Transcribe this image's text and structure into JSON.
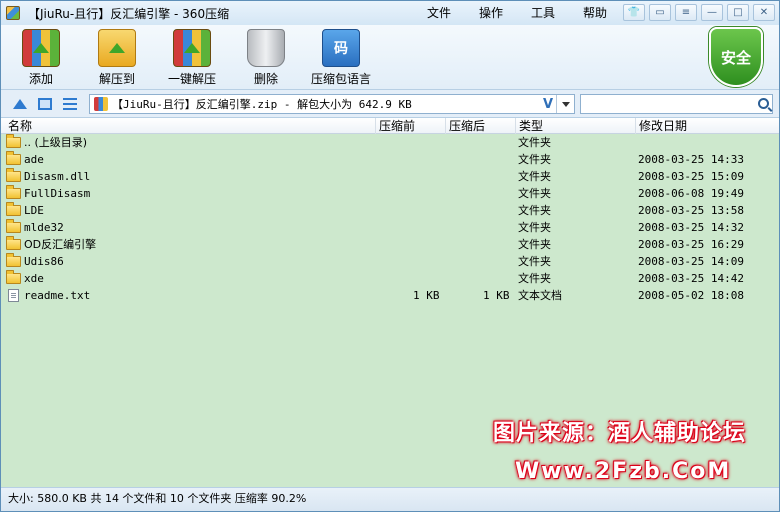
{
  "window": {
    "title": "【JiuRu-且行】反汇编引擎 - 360压缩"
  },
  "menu": [
    "文件",
    "操作",
    "工具",
    "帮助"
  ],
  "window_controls": {
    "skin": "👕",
    "feedback": "▭",
    "menu": "≡",
    "minimize": "—",
    "maximize": "□",
    "close": "✕"
  },
  "toolbar": [
    {
      "label": "添加",
      "icon": "add-archive-icon"
    },
    {
      "label": "解压到",
      "icon": "extract-to-icon"
    },
    {
      "label": "一键解压",
      "icon": "one-click-extract-icon"
    },
    {
      "label": "删除",
      "icon": "trash-icon"
    },
    {
      "label": "压缩包语言",
      "icon": "archive-language-icon",
      "glyph": "码"
    }
  ],
  "security_badge": "安全",
  "address": {
    "path": "【JiuRu-且行】反汇编引擎.zip - 解包大小为 642.9 KB",
    "v_marker": "V",
    "search_placeholder": ""
  },
  "columns": [
    "名称",
    "压缩前",
    "压缩后",
    "类型",
    "修改日期"
  ],
  "files": [
    {
      "name": ".. (上级目录)",
      "size": "",
      "packed": "",
      "type": "文件夹",
      "modified": "",
      "kind": "folder"
    },
    {
      "name": "ade",
      "size": "",
      "packed": "",
      "type": "文件夹",
      "modified": "2008-03-25 14:33",
      "kind": "folder"
    },
    {
      "name": "Disasm.dll",
      "size": "",
      "packed": "",
      "type": "文件夹",
      "modified": "2008-03-25 15:09",
      "kind": "folder"
    },
    {
      "name": "FullDisasm",
      "size": "",
      "packed": "",
      "type": "文件夹",
      "modified": "2008-06-08 19:49",
      "kind": "folder"
    },
    {
      "name": "LDE",
      "size": "",
      "packed": "",
      "type": "文件夹",
      "modified": "2008-03-25 13:58",
      "kind": "folder"
    },
    {
      "name": "mlde32",
      "size": "",
      "packed": "",
      "type": "文件夹",
      "modified": "2008-03-25 14:32",
      "kind": "folder"
    },
    {
      "name": "OD反汇编引擎",
      "size": "",
      "packed": "",
      "type": "文件夹",
      "modified": "2008-03-25 16:29",
      "kind": "folder"
    },
    {
      "name": "Udis86",
      "size": "",
      "packed": "",
      "type": "文件夹",
      "modified": "2008-03-25 14:09",
      "kind": "folder"
    },
    {
      "name": "xde",
      "size": "",
      "packed": "",
      "type": "文件夹",
      "modified": "2008-03-25 14:42",
      "kind": "folder"
    },
    {
      "name": "readme.txt",
      "size": "1 KB",
      "packed": "1 KB",
      "type": "文本文档",
      "modified": "2008-05-02 18:08",
      "kind": "file"
    }
  ],
  "watermark": {
    "line1": "图片来源：酒人辅助论坛",
    "line2": "Www.2Fzb.CoM"
  },
  "status": "大小: 580.0 KB 共 14 个文件和 10 个文件夹 压缩率 90.2%"
}
